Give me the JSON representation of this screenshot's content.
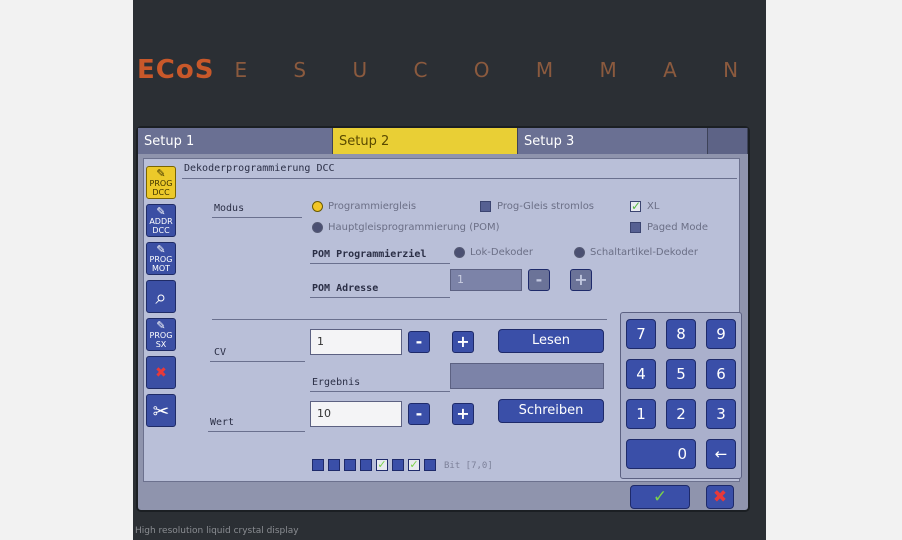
{
  "brand": {
    "logo": "ECoS",
    "tagline": "E S U   C O M M A N D   S T A T I O N"
  },
  "tabs": [
    {
      "label": "Setup 1",
      "active": false
    },
    {
      "label": "Setup 2",
      "active": true
    },
    {
      "label": "Setup 3",
      "active": false
    }
  ],
  "sidebar": [
    {
      "label": "PROG DCC",
      "icon": "wrench-icon",
      "active": true
    },
    {
      "label": "ADDR DCC",
      "icon": "wrench-icon",
      "active": false
    },
    {
      "label": "PROG MOT",
      "icon": "wrench-icon",
      "active": false
    },
    {
      "label": "",
      "icon": "magnifier-icon",
      "active": false
    },
    {
      "label": "PROG SX",
      "icon": "wrench-icon",
      "active": false
    },
    {
      "label": "",
      "icon": "loco-delete-icon",
      "active": false
    },
    {
      "label": "",
      "icon": "tools-icon",
      "active": false
    }
  ],
  "title": "Dekoderprogrammierung DCC",
  "modus": {
    "label": "Modus",
    "options": [
      "Programmiergleis",
      "Hauptgleisprogrammierung (POM)"
    ],
    "prog_stromlos": "Prog-Gleis stromlos",
    "xl": "XL",
    "paged_mode": "Paged Mode"
  },
  "pom": {
    "ziel_label": "POM Programmierziel",
    "ziel_options": [
      "Lok-Dekoder",
      "Schaltartikel-Dekoder"
    ],
    "adresse_label": "POM Adresse",
    "adresse_value": "1",
    "minus": "-",
    "plus": "+"
  },
  "cv": {
    "label": "CV",
    "value": "1",
    "minus": "-",
    "plus": "+",
    "lesen": "Lesen"
  },
  "ergebnis": {
    "label": "Ergebnis"
  },
  "wert": {
    "label": "Wert",
    "value": "10",
    "minus": "-",
    "plus": "+",
    "schreiben": "Schreiben"
  },
  "bits": {
    "label": "Bit [7,0]",
    "states": [
      false,
      false,
      false,
      false,
      true,
      false,
      true,
      false
    ]
  },
  "keypad": [
    "7",
    "8",
    "9",
    "4",
    "5",
    "6",
    "1",
    "2",
    "3",
    "0"
  ],
  "footer_text": "High resolution liquid crystal display",
  "colors": {
    "accent": "#ecc92a",
    "button": "#3a4fa8",
    "ok": "#7bd24a",
    "cancel": "#e8393a",
    "brand": "#c8582a"
  }
}
